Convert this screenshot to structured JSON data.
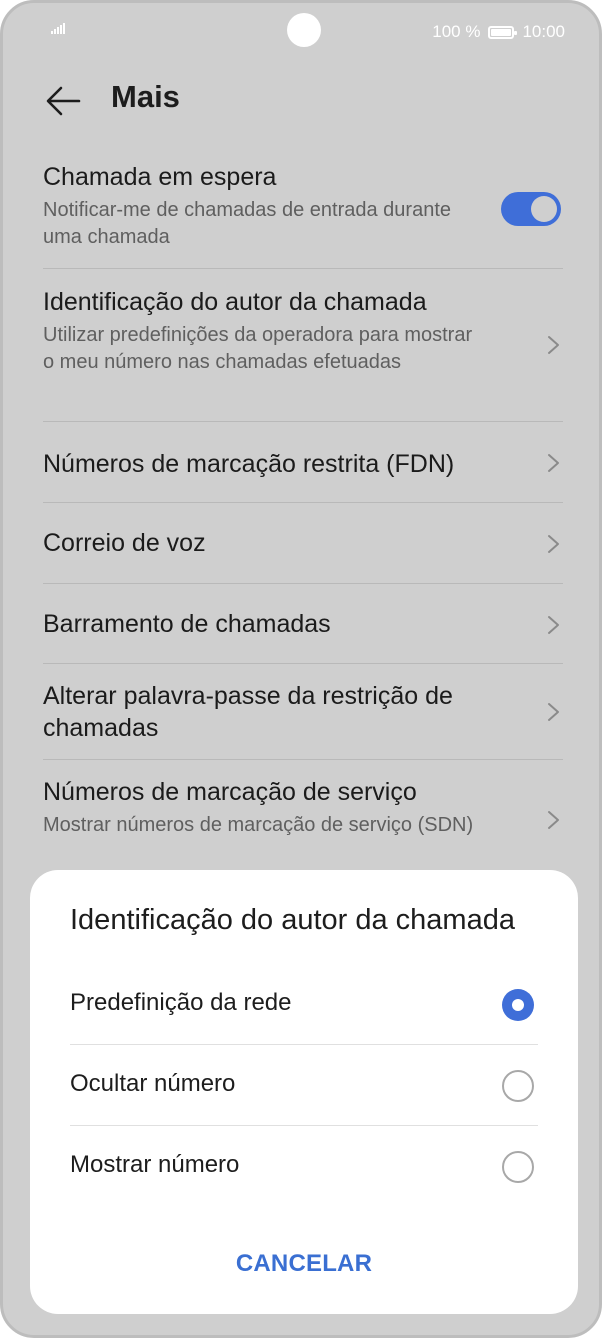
{
  "status_bar": {
    "battery_text": "100 %",
    "time": "10:00"
  },
  "header": {
    "title": "Mais",
    "back_icon": "arrow-left-icon"
  },
  "settings": {
    "call_waiting": {
      "title": "Chamada em espera",
      "subtitle": "Notificar-me de chamadas de entrada durante uma chamada",
      "enabled": true
    },
    "caller_id": {
      "title": "Identificação do autor da chamada",
      "subtitle": "Utilizar predefinições da operadora para mostrar o meu número nas chamadas efetuadas"
    },
    "fdn": {
      "title": "Números de marcação restrita (FDN)"
    },
    "voicemail": {
      "title": "Correio de voz"
    },
    "call_barring": {
      "title": "Barramento de chamadas"
    },
    "barring_password": {
      "title": "Alterar palavra-passe da restrição de chamadas"
    },
    "sdn": {
      "title": "Números de marcação de serviço",
      "subtitle": "Mostrar números de marcação de serviço (SDN)"
    }
  },
  "dialog": {
    "title": "Identificação do autor da chamada",
    "options": [
      {
        "label": "Predefinição da rede",
        "selected": true
      },
      {
        "label": "Ocultar número",
        "selected": false
      },
      {
        "label": "Mostrar número",
        "selected": false
      }
    ],
    "cancel_label": "CANCELAR"
  },
  "colors": {
    "accent": "#3f6ed8",
    "scrim_background": "#cfcfcf"
  }
}
